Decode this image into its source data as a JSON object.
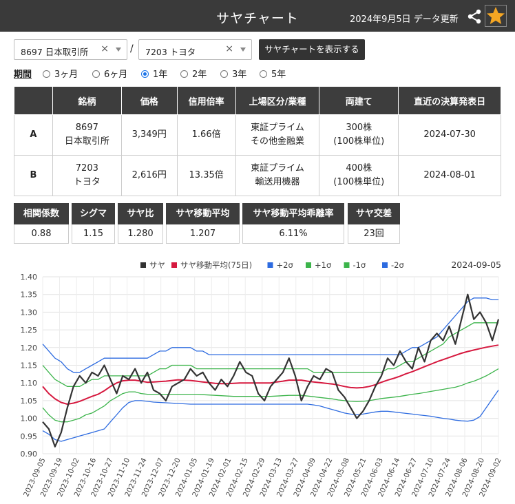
{
  "header": {
    "title": "サヤチャート",
    "date": "2024年9月5日 データ更新"
  },
  "selectors": {
    "a": {
      "value": "8697 日本取引所",
      "clear": "×"
    },
    "b": {
      "value": "7203 トヨタ",
      "clear": "×"
    },
    "separator": "/",
    "show_button": "サヤチャートを表示する"
  },
  "period": {
    "label": "期間",
    "options": [
      "3ヶ月",
      "6ヶ月",
      "1年",
      "2年",
      "3年",
      "5年"
    ],
    "selected": "1年"
  },
  "info_table": {
    "headers": [
      "",
      "銘柄",
      "価格",
      "信用倍率",
      "上場区分/業種",
      "両建て",
      "直近の決算発表日"
    ],
    "rows": [
      {
        "key": "A",
        "name1": "8697",
        "name2": "日本取引所",
        "price": "3,349円",
        "ratio": "1.66倍",
        "market1": "東証プライム",
        "market2": "その他金融業",
        "both1": "300株",
        "both2": "(100株単位)",
        "date": "2024-07-30"
      },
      {
        "key": "B",
        "name1": "7203",
        "name2": "トヨタ",
        "price": "2,616円",
        "ratio": "13.35倍",
        "market1": "東証プライム",
        "market2": "輸送用機器",
        "both1": "400株",
        "both2": "(100株単位)",
        "date": "2024-08-01"
      }
    ]
  },
  "stats": [
    {
      "label": "相関係数",
      "value": "0.88"
    },
    {
      "label": "シグマ",
      "value": "1.15"
    },
    {
      "label": "サヤ比",
      "value": "1.280"
    },
    {
      "label": "サヤ移動平均",
      "value": "1.207"
    },
    {
      "label": "サヤ移動平均乖離率",
      "value": "6.11%"
    },
    {
      "label": "サヤ交差",
      "value": "23回"
    }
  ],
  "chart_data": {
    "type": "line",
    "date_label": "2024-09-05",
    "ylim": [
      0.9,
      1.4
    ],
    "yticks": [
      "1.40",
      "1.35",
      "1.30",
      "1.25",
      "1.20",
      "1.15",
      "1.10",
      "1.05",
      "1.00",
      "0.95",
      "0.90"
    ],
    "xticks": [
      "2023-09-05",
      "2023-09-19",
      "2023-10-02",
      "2023-10-16",
      "2023-10-27",
      "2023-11-10",
      "2023-11-24",
      "2023-12-07",
      "2023-12-20",
      "2024-01-05",
      "2024-01-19",
      "2024-02-01",
      "2024-02-15",
      "2024-02-29",
      "2024-03-13",
      "2024-03-27",
      "2024-04-09",
      "2024-04-22",
      "2024-05-08",
      "2024-05-21",
      "2024-06-03",
      "2024-06-14",
      "2024-06-27",
      "2024-07-10",
      "2024-07-24",
      "2024-08-06",
      "2024-08-20",
      "2024-09-02"
    ],
    "grid": true,
    "legend_position": "top",
    "series": [
      {
        "name": "サヤ",
        "color": "#333333",
        "values": [
          0.99,
          0.97,
          0.92,
          0.96,
          1.03,
          1.09,
          1.12,
          1.1,
          1.13,
          1.12,
          1.15,
          1.11,
          1.07,
          1.12,
          1.11,
          1.14,
          1.1,
          1.13,
          1.08,
          1.07,
          1.05,
          1.09,
          1.1,
          1.11,
          1.14,
          1.12,
          1.13,
          1.1,
          1.08,
          1.11,
          1.09,
          1.12,
          1.16,
          1.13,
          1.12,
          1.07,
          1.05,
          1.09,
          1.11,
          1.13,
          1.17,
          1.12,
          1.05,
          1.09,
          1.12,
          1.11,
          1.14,
          1.13,
          1.08,
          1.06,
          1.03,
          1.0,
          1.02,
          1.05,
          1.09,
          1.12,
          1.17,
          1.15,
          1.19,
          1.16,
          1.14,
          1.2,
          1.16,
          1.22,
          1.24,
          1.22,
          1.26,
          1.21,
          1.28,
          1.35,
          1.28,
          1.3,
          1.27,
          1.22,
          1.28
        ]
      },
      {
        "name": "サヤ移動平均(75日)",
        "color": "#d6193f",
        "values": [
          1.09,
          1.07,
          1.055,
          1.045,
          1.04,
          1.043,
          1.048,
          1.055,
          1.062,
          1.068,
          1.078,
          1.09,
          1.1,
          1.106,
          1.108,
          1.108,
          1.105,
          1.102,
          1.103,
          1.104,
          1.105,
          1.107,
          1.109,
          1.108,
          1.107,
          1.105,
          1.103,
          1.101,
          1.099,
          1.098,
          1.098,
          1.099,
          1.1,
          1.1,
          1.1,
          1.1,
          1.1,
          1.1,
          1.103,
          1.105,
          1.108,
          1.108,
          1.108,
          1.105,
          1.103,
          1.101,
          1.099,
          1.097,
          1.094,
          1.09,
          1.087,
          1.086,
          1.087,
          1.09,
          1.095,
          1.102,
          1.108,
          1.113,
          1.119,
          1.126,
          1.132,
          1.139,
          1.146,
          1.153,
          1.16,
          1.166,
          1.172,
          1.178,
          1.184,
          1.189,
          1.193,
          1.197,
          1.201,
          1.204,
          1.207
        ]
      },
      {
        "name": "+2σ",
        "color": "#2d6be0",
        "values": [
          1.21,
          1.19,
          1.17,
          1.16,
          1.14,
          1.13,
          1.13,
          1.14,
          1.15,
          1.16,
          1.17,
          1.17,
          1.17,
          1.17,
          1.17,
          1.17,
          1.17,
          1.17,
          1.18,
          1.19,
          1.19,
          1.2,
          1.2,
          1.2,
          1.2,
          1.19,
          1.19,
          1.18,
          1.18,
          1.18,
          1.18,
          1.18,
          1.18,
          1.18,
          1.18,
          1.18,
          1.18,
          1.18,
          1.18,
          1.18,
          1.18,
          1.18,
          1.18,
          1.18,
          1.18,
          1.18,
          1.18,
          1.18,
          1.18,
          1.18,
          1.18,
          1.18,
          1.18,
          1.18,
          1.18,
          1.18,
          1.18,
          1.18,
          1.18,
          1.19,
          1.2,
          1.2,
          1.21,
          1.22,
          1.23,
          1.25,
          1.27,
          1.29,
          1.31,
          1.33,
          1.34,
          1.34,
          1.34,
          1.335,
          1.335
        ]
      },
      {
        "name": "+1σ",
        "color": "#3cb44b",
        "values": [
          1.15,
          1.13,
          1.11,
          1.1,
          1.09,
          1.09,
          1.09,
          1.1,
          1.11,
          1.11,
          1.12,
          1.12,
          1.12,
          1.12,
          1.12,
          1.12,
          1.12,
          1.12,
          1.13,
          1.14,
          1.14,
          1.15,
          1.15,
          1.15,
          1.15,
          1.14,
          1.14,
          1.14,
          1.14,
          1.14,
          1.14,
          1.14,
          1.14,
          1.14,
          1.14,
          1.14,
          1.14,
          1.14,
          1.14,
          1.14,
          1.14,
          1.14,
          1.14,
          1.14,
          1.13,
          1.13,
          1.13,
          1.13,
          1.13,
          1.13,
          1.13,
          1.13,
          1.13,
          1.13,
          1.13,
          1.13,
          1.14,
          1.14,
          1.15,
          1.16,
          1.16,
          1.17,
          1.18,
          1.19,
          1.2,
          1.21,
          1.23,
          1.24,
          1.25,
          1.26,
          1.27,
          1.27,
          1.27,
          1.27,
          1.27
        ]
      },
      {
        "name": "-1σ",
        "color": "#3cb44b",
        "values": [
          1.03,
          1.01,
          0.995,
          0.99,
          0.99,
          0.995,
          1.0,
          1.01,
          1.015,
          1.025,
          1.035,
          1.05,
          1.06,
          1.07,
          1.075,
          1.075,
          1.07,
          1.068,
          1.068,
          1.068,
          1.068,
          1.068,
          1.068,
          1.068,
          1.068,
          1.068,
          1.067,
          1.066,
          1.065,
          1.064,
          1.063,
          1.062,
          1.062,
          1.062,
          1.062,
          1.062,
          1.062,
          1.062,
          1.063,
          1.064,
          1.065,
          1.065,
          1.065,
          1.063,
          1.061,
          1.059,
          1.057,
          1.055,
          1.052,
          1.05,
          1.048,
          1.047,
          1.048,
          1.05,
          1.053,
          1.056,
          1.058,
          1.06,
          1.062,
          1.065,
          1.068,
          1.07,
          1.073,
          1.076,
          1.079,
          1.082,
          1.085,
          1.088,
          1.093,
          1.1,
          1.105,
          1.112,
          1.12,
          1.13,
          1.14
        ]
      },
      {
        "name": "-2σ",
        "color": "#2d6be0",
        "values": [
          0.965,
          0.955,
          0.94,
          0.935,
          0.94,
          0.945,
          0.95,
          0.955,
          0.96,
          0.965,
          0.97,
          0.99,
          1.01,
          1.03,
          1.045,
          1.05,
          1.05,
          1.048,
          1.046,
          1.045,
          1.044,
          1.043,
          1.042,
          1.041,
          1.04,
          1.04,
          1.04,
          1.04,
          1.04,
          1.04,
          1.04,
          1.04,
          1.04,
          1.04,
          1.04,
          1.04,
          1.04,
          1.04,
          1.04,
          1.04,
          1.04,
          1.04,
          1.04,
          1.04,
          1.038,
          1.035,
          1.03,
          1.025,
          1.02,
          1.015,
          1.012,
          1.01,
          1.012,
          1.015,
          1.018,
          1.02,
          1.02,
          1.018,
          1.016,
          1.014,
          1.012,
          1.01,
          1.008,
          1.006,
          1.003,
          1.0,
          0.998,
          0.995,
          0.993,
          0.992,
          0.995,
          1.005,
          1.03,
          1.055,
          1.08
        ]
      }
    ]
  }
}
